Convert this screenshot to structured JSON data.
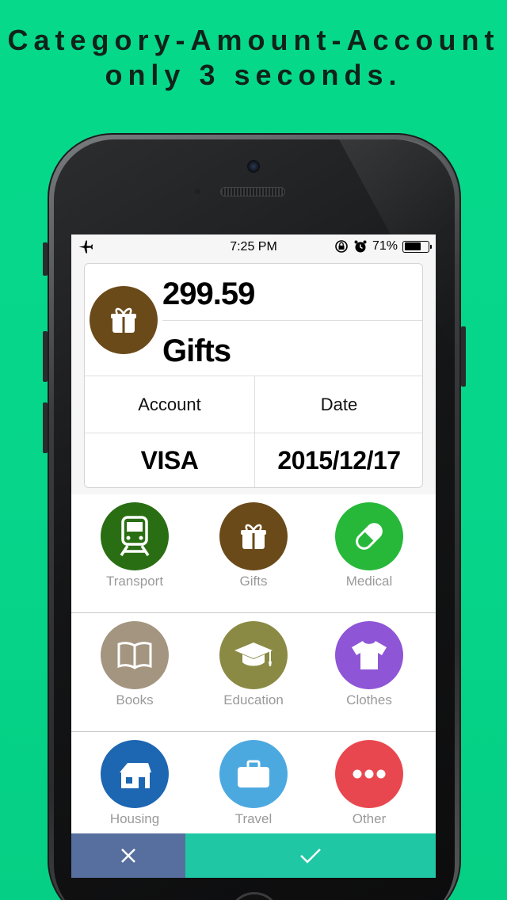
{
  "headline": {
    "line1": "Category-Amount-Account",
    "line2": "only 3 seconds."
  },
  "status_bar": {
    "time": "7:25 PM",
    "battery": "71%",
    "battery_level": 0.71,
    "icons": [
      "airplane-icon",
      "rotation-lock-icon",
      "alarm-icon",
      "battery-icon"
    ]
  },
  "entry": {
    "amount": "299.59",
    "category": "Gifts",
    "category_icon": "gift-icon",
    "category_color": "#6b4a1a",
    "account_label": "Account",
    "date_label": "Date",
    "account_value": "VISA",
    "date_value": "2015/12/17"
  },
  "categories": [
    {
      "label": "Transport",
      "icon": "train-icon",
      "color": "#2a6e14"
    },
    {
      "label": "Gifts",
      "icon": "gift-icon",
      "color": "#6b4a1a"
    },
    {
      "label": "Medical",
      "icon": "pill-icon",
      "color": "#27b83a"
    },
    {
      "label": "Books",
      "icon": "book-icon",
      "color": "#a49580"
    },
    {
      "label": "Education",
      "icon": "graduation-cap-icon",
      "color": "#8a8a44"
    },
    {
      "label": "Clothes",
      "icon": "tshirt-icon",
      "color": "#8e55d6"
    },
    {
      "label": "Housing",
      "icon": "house-icon",
      "color": "#1d66b2"
    },
    {
      "label": "Travel",
      "icon": "suitcase-icon",
      "color": "#4ca9e0"
    },
    {
      "label": "Other",
      "icon": "more-icon",
      "color": "#e9474f"
    }
  ],
  "actions": {
    "cancel_icon": "close-icon",
    "confirm_icon": "check-icon",
    "cancel_color": "#576f9e",
    "confirm_color": "#1fc7a4"
  }
}
